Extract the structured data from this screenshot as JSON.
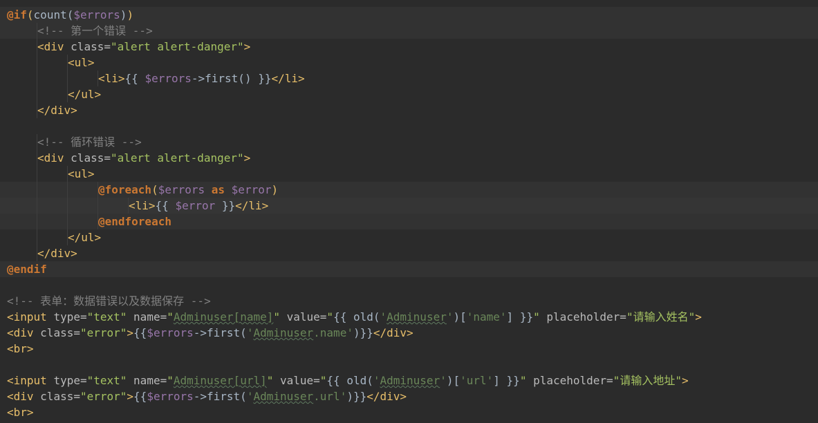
{
  "editor": {
    "lines": [
      {
        "indent": 0,
        "hl": "hl",
        "tokens": [
          [
            "directive",
            "@if"
          ],
          [
            "paren",
            "("
          ],
          [
            "func",
            "count"
          ],
          [
            "plain",
            "("
          ],
          [
            "var",
            "$errors"
          ],
          [
            "plain",
            ")"
          ],
          [
            "paren",
            ")"
          ]
        ]
      },
      {
        "indent": 1,
        "hl": "hl",
        "tokens": [
          [
            "comment",
            "<!-- 第一个错误 -->"
          ]
        ]
      },
      {
        "indent": 1,
        "hl": "",
        "tokens": [
          [
            "tag",
            "<div "
          ],
          [
            "attr",
            "class="
          ],
          [
            "str",
            "\"alert alert-danger\""
          ],
          [
            "tag",
            ">"
          ]
        ]
      },
      {
        "indent": 2,
        "hl": "",
        "tokens": [
          [
            "tag",
            "<ul>"
          ]
        ]
      },
      {
        "indent": 3,
        "hl": "",
        "tokens": [
          [
            "tag",
            "<li>"
          ],
          [
            "plain",
            "{{ "
          ],
          [
            "var",
            "$errors"
          ],
          [
            "plain",
            "->first() }}"
          ],
          [
            "tag",
            "</li>"
          ]
        ]
      },
      {
        "indent": 2,
        "hl": "",
        "tokens": [
          [
            "tag",
            "</ul>"
          ]
        ]
      },
      {
        "indent": 1,
        "hl": "",
        "tokens": [
          [
            "tag",
            "</div>"
          ]
        ]
      },
      {
        "indent": 0,
        "hl": "",
        "tokens": []
      },
      {
        "indent": 1,
        "hl": "",
        "tokens": [
          [
            "comment",
            "<!-- 循环错误 -->"
          ]
        ]
      },
      {
        "indent": 1,
        "hl": "",
        "tokens": [
          [
            "tag",
            "<div "
          ],
          [
            "attr",
            "class="
          ],
          [
            "str",
            "\"alert alert-danger\""
          ],
          [
            "tag",
            ">"
          ]
        ]
      },
      {
        "indent": 2,
        "hl": "",
        "tokens": [
          [
            "tag",
            "<ul>"
          ]
        ]
      },
      {
        "indent": 3,
        "hl": "hl",
        "tokens": [
          [
            "directive",
            "@foreach"
          ],
          [
            "paren",
            "("
          ],
          [
            "var",
            "$errors "
          ],
          [
            "keyword",
            "as "
          ],
          [
            "var",
            "$error"
          ],
          [
            "paren",
            ")"
          ]
        ]
      },
      {
        "indent": 4,
        "hl": "hl-strong",
        "tokens": [
          [
            "tag",
            "<li>"
          ],
          [
            "plain",
            "{{ "
          ],
          [
            "var",
            "$error"
          ],
          [
            "plain",
            " }}"
          ],
          [
            "tag",
            "</li>"
          ]
        ]
      },
      {
        "indent": 3,
        "hl": "hl",
        "tokens": [
          [
            "directive",
            "@endforeach"
          ]
        ]
      },
      {
        "indent": 2,
        "hl": "",
        "tokens": [
          [
            "tag",
            "</ul>"
          ]
        ]
      },
      {
        "indent": 1,
        "hl": "",
        "tokens": [
          [
            "tag",
            "</div>"
          ]
        ]
      },
      {
        "indent": 0,
        "hl": "hl",
        "tokens": [
          [
            "directive",
            "@endif"
          ]
        ]
      },
      {
        "indent": 0,
        "hl": "",
        "tokens": []
      },
      {
        "indent": 0,
        "hl": "",
        "tokens": [
          [
            "comment",
            "<!-- 表单：数据错误以及数据保存 -->"
          ]
        ]
      },
      {
        "indent": 0,
        "hl": "",
        "tokens": [
          [
            "tag",
            "<input "
          ],
          [
            "attr",
            "type="
          ],
          [
            "str",
            "\"text\" "
          ],
          [
            "attr",
            "name="
          ],
          [
            "str",
            "\""
          ],
          [
            "ident",
            "Adminuser[name]"
          ],
          [
            "str",
            "\" "
          ],
          [
            "attr",
            "value="
          ],
          [
            "str",
            "\""
          ],
          [
            "plain",
            "{{ old("
          ],
          [
            "sstr",
            "'"
          ],
          [
            "ident",
            "Adminuser"
          ],
          [
            "sstr",
            "'"
          ],
          [
            "plain",
            ")["
          ],
          [
            "sstr",
            "'name'"
          ],
          [
            "plain",
            "] }}"
          ],
          [
            "str",
            "\" "
          ],
          [
            "attr",
            "placeholder="
          ],
          [
            "str",
            "\""
          ],
          [
            "cn",
            "请输入姓名"
          ],
          [
            "str",
            "\""
          ],
          [
            "tag",
            ">"
          ]
        ]
      },
      {
        "indent": 0,
        "hl": "",
        "tokens": [
          [
            "tag",
            "<div "
          ],
          [
            "attr",
            "class="
          ],
          [
            "str",
            "\"error\""
          ],
          [
            "tag",
            ">"
          ],
          [
            "plain",
            "{{"
          ],
          [
            "var",
            "$errors"
          ],
          [
            "plain",
            "->first("
          ],
          [
            "sstr",
            "'"
          ],
          [
            "ident",
            "Adminuser"
          ],
          [
            "sstr",
            ".name'"
          ],
          [
            "plain",
            ")}}"
          ],
          [
            "tag",
            "</div>"
          ]
        ]
      },
      {
        "indent": 0,
        "hl": "",
        "tokens": [
          [
            "tag",
            "<br>"
          ]
        ]
      },
      {
        "indent": 0,
        "hl": "",
        "tokens": []
      },
      {
        "indent": 0,
        "hl": "",
        "tokens": [
          [
            "tag",
            "<input "
          ],
          [
            "attr",
            "type="
          ],
          [
            "str",
            "\"text\" "
          ],
          [
            "attr",
            "name="
          ],
          [
            "str",
            "\""
          ],
          [
            "ident",
            "Adminuser[url]"
          ],
          [
            "str",
            "\" "
          ],
          [
            "attr",
            "value="
          ],
          [
            "str",
            "\""
          ],
          [
            "plain",
            "{{ old("
          ],
          [
            "sstr",
            "'"
          ],
          [
            "ident",
            "Adminuser"
          ],
          [
            "sstr",
            "'"
          ],
          [
            "plain",
            ")["
          ],
          [
            "sstr",
            "'url'"
          ],
          [
            "plain",
            "] }}"
          ],
          [
            "str",
            "\" "
          ],
          [
            "attr",
            "placeholder="
          ],
          [
            "str",
            "\""
          ],
          [
            "cn",
            "请输入地址"
          ],
          [
            "str",
            "\""
          ],
          [
            "tag",
            ">"
          ]
        ]
      },
      {
        "indent": 0,
        "hl": "",
        "tokens": [
          [
            "tag",
            "<div "
          ],
          [
            "attr",
            "class="
          ],
          [
            "str",
            "\"error\""
          ],
          [
            "tag",
            ">"
          ],
          [
            "plain",
            "{{"
          ],
          [
            "var",
            "$errors"
          ],
          [
            "plain",
            "->first("
          ],
          [
            "sstr",
            "'"
          ],
          [
            "ident",
            "Adminuser"
          ],
          [
            "sstr",
            ".url'"
          ],
          [
            "plain",
            ")}}"
          ],
          [
            "tag",
            "</div>"
          ]
        ]
      },
      {
        "indent": 0,
        "hl": "",
        "tokens": [
          [
            "tag",
            "<br>"
          ]
        ]
      }
    ]
  }
}
